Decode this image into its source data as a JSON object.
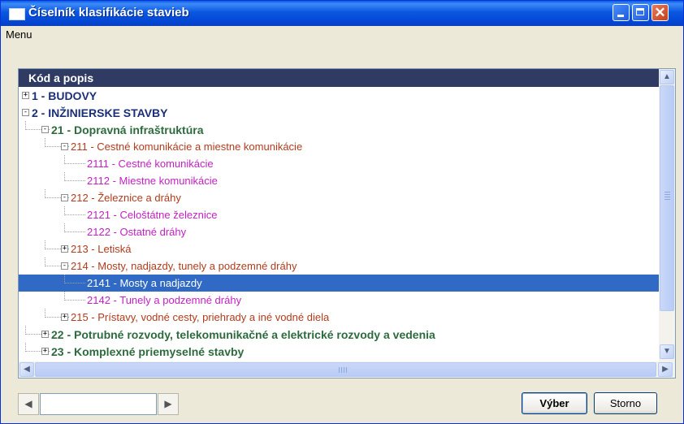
{
  "window": {
    "title": "Číselník klasifikácie stavieb",
    "controls": {
      "minimize": "minimize-icon",
      "maximize": "maximize-icon",
      "close_glyph": "✕"
    }
  },
  "menu": {
    "items": [
      "Menu"
    ]
  },
  "tree": {
    "column_header": "Kód a popis",
    "rows": [
      {
        "level": 1,
        "expander": "+",
        "text": "1 - BUDOVY"
      },
      {
        "level": 1,
        "expander": "−",
        "text": "2 - INŽINIERSKE STAVBY"
      },
      {
        "level": 2,
        "expander": "−",
        "text": "21 - Dopravná infraštruktúra"
      },
      {
        "level": 3,
        "expander": "−",
        "text": "211 - Cestné komunikácie a miestne komunikácie"
      },
      {
        "level": 4,
        "expander": "",
        "text": "2111 - Cestné komunikácie"
      },
      {
        "level": 4,
        "expander": "",
        "text": "2112 - Miestne komunikácie"
      },
      {
        "level": 3,
        "expander": "−",
        "text": "212 - Železnice a dráhy"
      },
      {
        "level": 4,
        "expander": "",
        "text": "2121 - Celoštátne železnice"
      },
      {
        "level": 4,
        "expander": "",
        "text": "2122 - Ostatné dráhy"
      },
      {
        "level": 3,
        "expander": "+",
        "text": "213 - Letiská"
      },
      {
        "level": 3,
        "expander": "−",
        "text": "214 - Mosty, nadjazdy, tunely a podzemné dráhy"
      },
      {
        "level": 4,
        "expander": "",
        "text": "2141 - Mosty a nadjazdy",
        "selected": true
      },
      {
        "level": 4,
        "expander": "",
        "text": "2142 - Tunely a podzemné dráhy"
      },
      {
        "level": 3,
        "expander": "+",
        "text": "215 - Prístavy, vodné cesty, priehrady a iné vodné diela"
      },
      {
        "level": 2,
        "expander": "+",
        "text": "22 - Potrubné rozvody, telekomunikačné a elektrické rozvody a vedenia"
      },
      {
        "level": 2,
        "expander": "+",
        "text": "23 - Komplexné priemyselné stavby"
      }
    ]
  },
  "navigator": {
    "prev_glyph": "◀",
    "next_glyph": "▶",
    "input_value": ""
  },
  "buttons": {
    "ok": "Výber",
    "cancel": "Storno"
  },
  "scrollbars": {
    "up": "▲",
    "down": "▼",
    "left": "◀",
    "right": "▶"
  },
  "colors": {
    "header_bg": "#2f3b63",
    "selection": "#316ac5",
    "level1": "#1a2f78",
    "level2": "#2d6b3e",
    "level3": "#b23b1c",
    "level4": "#c41fc4"
  }
}
